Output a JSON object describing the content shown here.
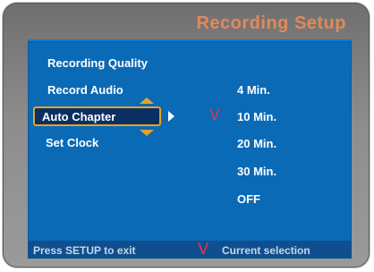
{
  "header": {
    "title": "Recording Setup"
  },
  "menu": {
    "items": [
      {
        "label": "Recording Quality"
      },
      {
        "label": "Record Audio"
      },
      {
        "label": "Auto Chapter"
      },
      {
        "label": "Set Clock"
      }
    ]
  },
  "options": {
    "items": [
      {
        "label": "4 Min."
      },
      {
        "label": "10 Min."
      },
      {
        "label": "20 Min."
      },
      {
        "label": "30 Min."
      },
      {
        "label": "OFF"
      }
    ],
    "check_mark": "V"
  },
  "footer": {
    "exit_hint": "Press SETUP to exit",
    "legend_mark": "V",
    "legend_text": "Current selection"
  },
  "colors": {
    "screen_bg": "#0b6ab6",
    "highlight_border": "#e6a324",
    "check_mark": "#e0344c",
    "title": "#e08a5a"
  }
}
